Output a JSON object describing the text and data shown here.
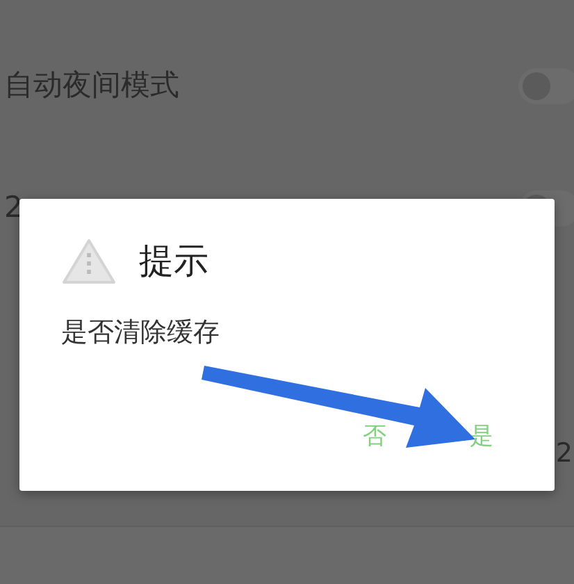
{
  "settings": [
    {
      "label": "自动夜间模式",
      "kind": "toggle",
      "on": false
    },
    {
      "label": "2",
      "kind": "toggle",
      "on": false
    },
    {
      "kind": "plain"
    },
    {
      "kind": "value",
      "value": "2"
    }
  ],
  "dialog": {
    "title": "提示",
    "message": "是否清除缓存",
    "buttons": [
      "否",
      "是"
    ]
  }
}
